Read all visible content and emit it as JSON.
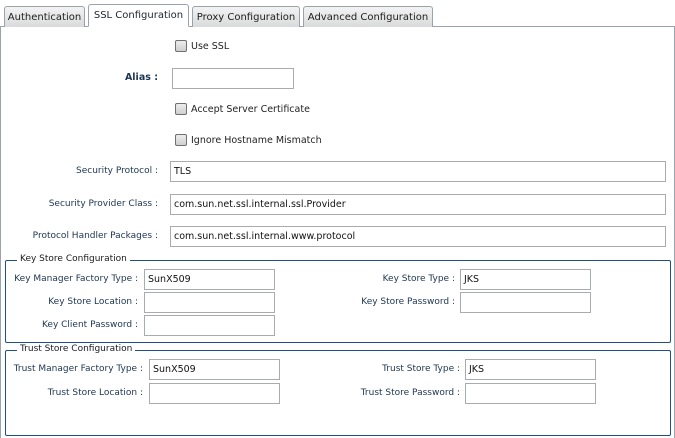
{
  "tabs": [
    {
      "label": "Authentication",
      "active": false
    },
    {
      "label": "SSL Configuration",
      "active": true
    },
    {
      "label": "Proxy Configuration",
      "active": false
    },
    {
      "label": "Advanced Configuration",
      "active": false
    }
  ],
  "use_ssl": {
    "label": "Use SSL",
    "checked": false
  },
  "alias": {
    "label": "Alias :",
    "value": ""
  },
  "accept_server_certificate": {
    "label": "Accept Server Certificate",
    "checked": false
  },
  "ignore_hostname_mismatch": {
    "label": "Ignore Hostname Mismatch",
    "checked": false
  },
  "security_protocol": {
    "label": "Security Protocol :",
    "value": "TLS"
  },
  "security_provider_class": {
    "label": "Security Provider Class :",
    "value": "com.sun.net.ssl.internal.ssl.Provider"
  },
  "protocol_handler_packages": {
    "label": "Protocol Handler Packages :",
    "value": "com.sun.net.ssl.internal.www.protocol"
  },
  "key_store": {
    "legend": "Key Store Configuration",
    "key_manager_factory_type": {
      "label": "Key Manager Factory Type :",
      "value": "SunX509"
    },
    "key_store_type": {
      "label": "Key Store Type :",
      "value": "JKS"
    },
    "key_store_location": {
      "label": "Key Store Location :",
      "value": ""
    },
    "key_store_password": {
      "label": "Key Store Password :",
      "value": ""
    },
    "key_client_password": {
      "label": "Key Client Password :",
      "value": ""
    }
  },
  "trust_store": {
    "legend": "Trust Store Configuration",
    "trust_manager_factory_type": {
      "label": "Trust Manager Factory Type :",
      "value": "SunX509"
    },
    "trust_store_type": {
      "label": "Trust Store Type :",
      "value": "JKS"
    },
    "trust_store_location": {
      "label": "Trust Store Location :",
      "value": ""
    },
    "trust_store_password": {
      "label": "Trust Store Password :",
      "value": ""
    }
  }
}
